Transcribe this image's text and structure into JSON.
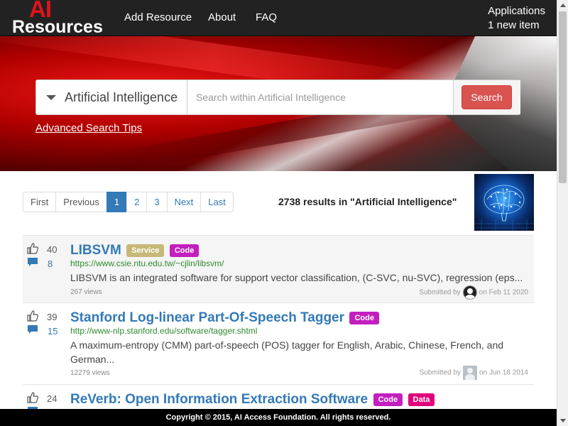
{
  "logo": {
    "line1": "AI",
    "line2": "Resources"
  },
  "nav": {
    "add_resource": "Add Resource",
    "about": "About",
    "faq": "FAQ"
  },
  "applications": {
    "title": "Applications",
    "subtitle": "1 new item"
  },
  "search": {
    "scope": "Artificial Intelligence",
    "placeholder": "Search within Artificial Intelligence",
    "button": "Search",
    "advanced_tips": "Advanced Search Tips"
  },
  "pagination": {
    "first": "First",
    "previous": "Previous",
    "pages": [
      "1",
      "2",
      "3"
    ],
    "current_page": "1",
    "next": "Next",
    "last": "Last"
  },
  "results_summary": "2738 results in \"Artificial Intelligence\"",
  "results": [
    {
      "votes": "40",
      "comments": "8",
      "title": "LIBSVM",
      "badges": [
        {
          "label": "Service",
          "color": "#c8b878"
        },
        {
          "label": "Code",
          "color": "#c31fbf"
        }
      ],
      "url": "https://www.csie.ntu.edu.tw/~cjlin/libsvm/",
      "description": "LIBSVM is an integrated software for support vector classification, (C-SVC, nu-SVC), regression (eps...",
      "views": "267 views",
      "submitted_prefix": "Submitted by",
      "submitted_date": "on Feb 11 2020"
    },
    {
      "votes": "39",
      "comments": "15",
      "title": "Stanford Log-linear Part-Of-Speech Tagger",
      "badges": [
        {
          "label": "Code",
          "color": "#c31fbf"
        }
      ],
      "url": "http://www-nlp.stanford.edu/software/tagger.shtml",
      "description": "A maximum-entropy (CMM) part-of-speech (POS) tagger for English, Arabic, Chinese, French, and German...",
      "views": "12279 views",
      "submitted_prefix": "Submitted by",
      "submitted_date": "on Jun 18 2014"
    },
    {
      "votes": "24",
      "title": "ReVerb: Open Information Extraction Software",
      "badges": [
        {
          "label": "Code",
          "color": "#c31fbf"
        },
        {
          "label": "Data",
          "color": "#e2007a"
        }
      ]
    }
  ],
  "footer": "Copyright © 2015, AI Access Foundation. All rights reserved.",
  "colors": {
    "navbar": "#222222",
    "accent_red": "#d9534f",
    "link_blue": "#337ab7",
    "url_green": "#2e8b2e",
    "logo_red": "#e0131b"
  }
}
